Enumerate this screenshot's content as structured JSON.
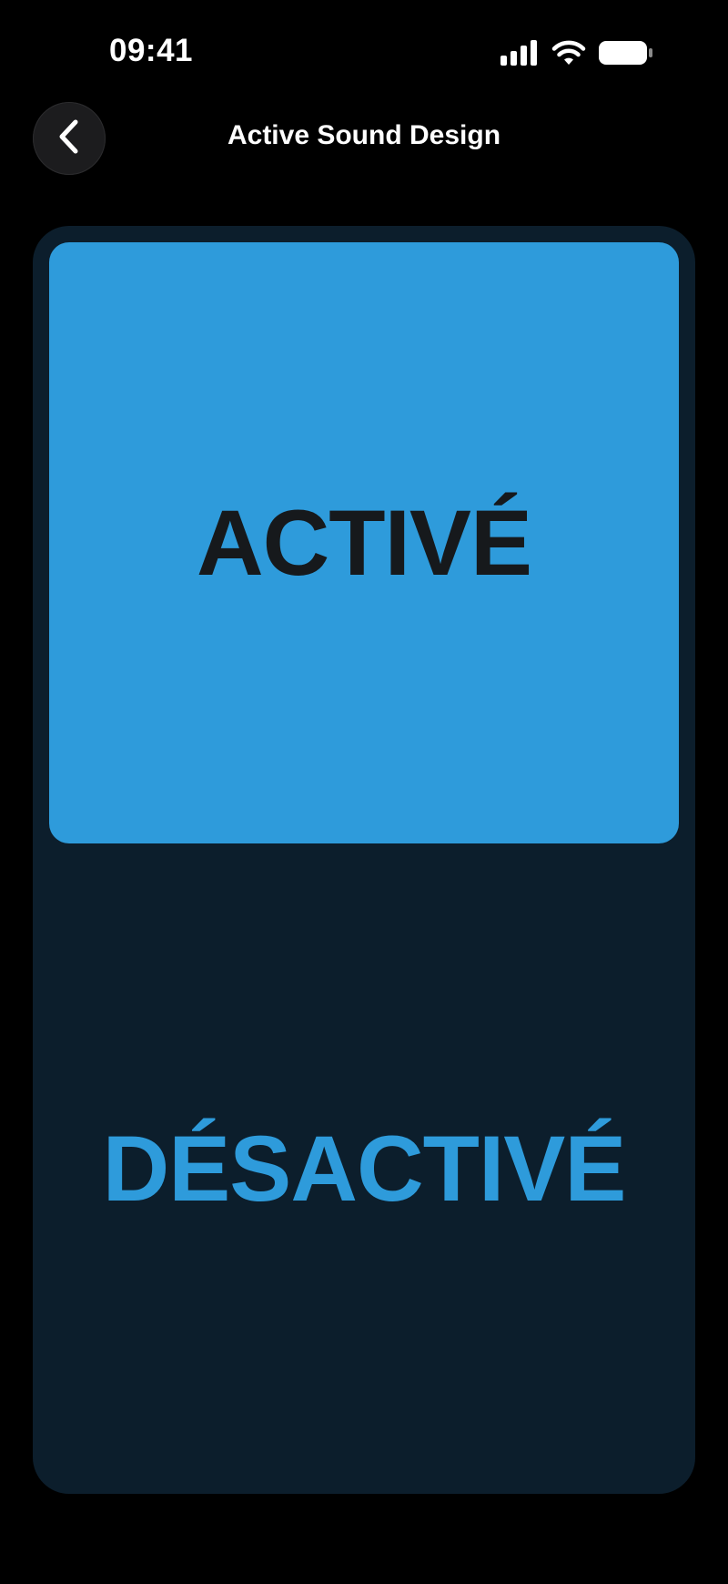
{
  "status_bar": {
    "time": "09:41",
    "icons": [
      "cellular-signal-icon",
      "wifi-icon",
      "battery-icon"
    ]
  },
  "header": {
    "back_icon": "chevron-left-icon",
    "title": "Active Sound Design"
  },
  "toggle": {
    "options": [
      {
        "label": "ACTIVÉ",
        "selected": true
      },
      {
        "label": "DÉSACTIVÉ",
        "selected": false
      }
    ]
  },
  "colors": {
    "background": "#000000",
    "panel": "#0c1e2c",
    "accent": "#2e9bdb",
    "selected_text": "#16191c",
    "button_bg": "#1c1c1e"
  }
}
